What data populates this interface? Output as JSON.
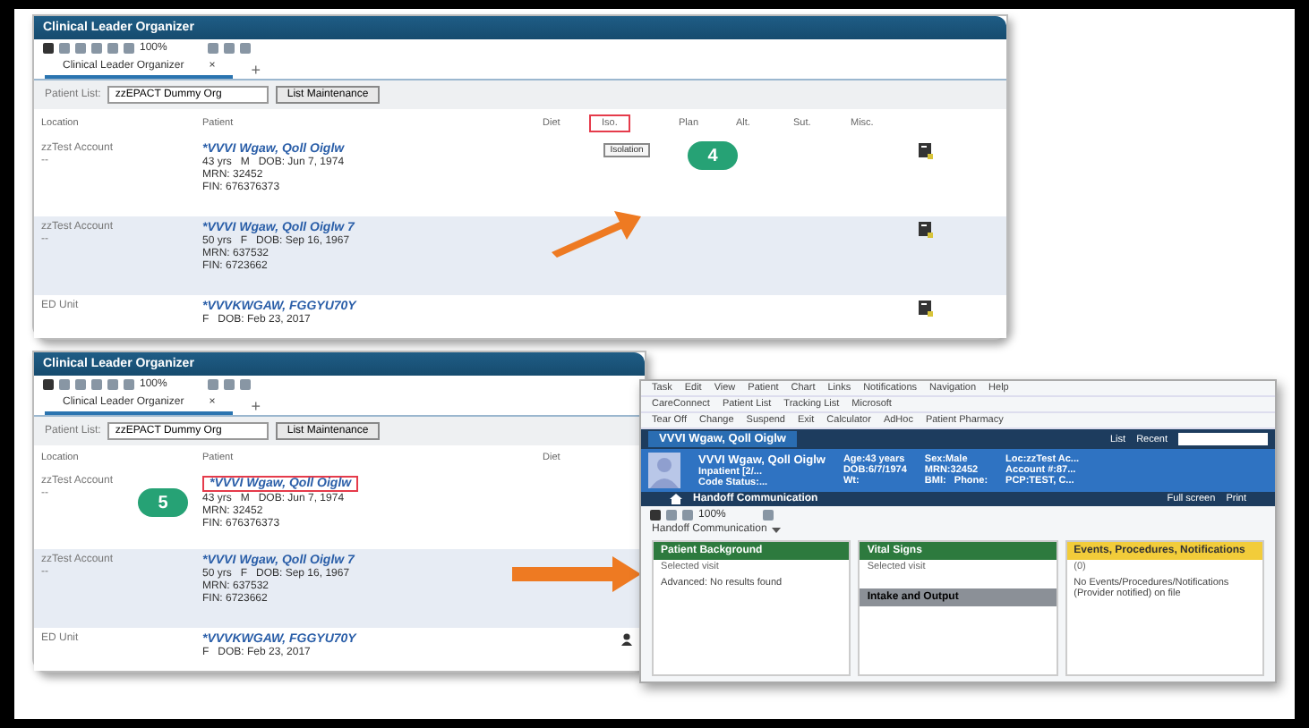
{
  "organizers": [
    {
      "title": "Clinical Leader Organizer",
      "zoom": "100%",
      "tab": {
        "label": "Clinical Leader Organizer",
        "close": "×"
      },
      "add_tab": "+",
      "patient_list": {
        "label": "Patient List:",
        "value": "zzEPACT Dummy Org"
      },
      "list_button": "List Maintenance",
      "columns": [
        {
          "label": "Location",
          "highlighted": false
        },
        {
          "label": "Patient",
          "highlighted": false
        },
        {
          "label": "Diet",
          "highlighted": false
        },
        {
          "label": "Iso.",
          "highlighted": true
        },
        {
          "label": "Plan",
          "highlighted": false
        },
        {
          "label": "Alt.",
          "highlighted": false
        },
        {
          "label": "Sut.",
          "highlighted": false
        },
        {
          "label": "Misc.",
          "highlighted": false
        }
      ],
      "callout": {
        "number": "4"
      },
      "rows": [
        {
          "location": "zzTest Account",
          "location_note": "--",
          "name": "*VVVI Wgaw, Qoll Oiglw",
          "name_highlighted": false,
          "details": [
            "43 yrs   M   DOB: Jun 7, 1974",
            "MRN: 32452",
            "FIN: 676376373"
          ],
          "shaded": false,
          "isolation": "Isolation",
          "note": true
        },
        {
          "location": "zzTest Account",
          "location_note": "--",
          "name": "*VVVI Wgaw, Qoll Oiglw 7",
          "name_highlighted": false,
          "details": [
            "50 yrs   F   DOB: Sep 16, 1967",
            "MRN: 637532",
            "FIN: 6723662"
          ],
          "shaded": true,
          "note": true
        },
        {
          "location": "ED Unit",
          "name": "*VVVKWGAW, FGGYU70Y",
          "name_highlighted": false,
          "details": [
            "F   DOB: Feb 23, 2017"
          ],
          "shaded": false,
          "note": true
        }
      ]
    },
    {
      "title": "Clinical Leader Organizer",
      "zoom": "100%",
      "tab": {
        "label": "Clinical Leader Organizer",
        "close": "×"
      },
      "add_tab": "+",
      "patient_list": {
        "label": "Patient List:",
        "value": "zzEPACT Dummy Org"
      },
      "list_button": "List Maintenance",
      "columns": [
        {
          "label": "Location",
          "highlighted": false
        },
        {
          "label": "Patient",
          "highlighted": false
        },
        {
          "label": "Diet",
          "highlighted": false
        }
      ],
      "callout": {
        "number": "5"
      },
      "rows": [
        {
          "location": "zzTest Account",
          "location_note": "--",
          "name": "*VVVI Wgaw, Qoll Oiglw",
          "name_highlighted": true,
          "details": [
            "43 yrs   M   DOB: Jun 7, 1974",
            "MRN: 32452",
            "FIN: 676376373"
          ],
          "shaded": false,
          "person": false
        },
        {
          "location": "zzTest Account",
          "location_note": "--",
          "name": "*VVVI Wgaw, Qoll Oiglw 7",
          "name_highlighted": false,
          "details": [
            "50 yrs   F   DOB: Sep 16, 1967",
            "MRN: 637532",
            "FIN: 6723662"
          ],
          "shaded": true,
          "person": false
        },
        {
          "location": "ED Unit",
          "name": "*VVVKWGAW, FGGYU70Y",
          "name_highlighted": false,
          "details": [
            "F   DOB: Feb 23, 2017"
          ],
          "shaded": false,
          "person": true
        }
      ]
    }
  ],
  "chart_window": {
    "menu": [
      "Task",
      "Edit",
      "View",
      "Patient",
      "Chart",
      "Links",
      "Notifications",
      "Navigation",
      "Help"
    ],
    "toolbar_1": [
      "CareConnect",
      "Patient List",
      "Tracking List",
      "Microsoft"
    ],
    "toolbar_2": [
      "Tear Off",
      "Change",
      "Suspend",
      "Exit",
      "Calculator",
      "AdHoc",
      "Patient Pharmacy"
    ],
    "patient_tab": "VVVI Wgaw, Qoll Oiglw",
    "nav": [
      "List",
      "Recent"
    ],
    "banner": [
      [
        "VVVI Wgaw, Qoll Oiglw",
        "Inpatient [2/...",
        "Code Status:..."
      ],
      [
        "Age:43 years",
        "DOB:6/7/1974",
        "Wt:"
      ],
      [
        "Sex:Male",
        "MRN:32452",
        "BMI:   Phone:"
      ],
      [
        "Loc:zzTest Ac...",
        "Account #:87...",
        "PCP:TEST, C..."
      ]
    ],
    "page_title": "Handoff Communication",
    "page_actions": [
      "Full screen",
      "Print"
    ],
    "zoom": "100%",
    "view_select": "Handoff Communication",
    "components": [
      {
        "kind": "background",
        "title": "Patient Background",
        "sub": "Selected visit",
        "lines": [
          "Advanced: No results found"
        ]
      },
      {
        "kind": "vitals",
        "title": "Vital Signs",
        "sub": "Selected visit",
        "below": {
          "title": "Intake and Output"
        }
      },
      {
        "kind": "events",
        "title": "Events, Procedures, Notifications",
        "sub": "(0)",
        "lines": [
          "No Events/Procedures/Notifications (Provider notified) on file"
        ]
      }
    ]
  }
}
